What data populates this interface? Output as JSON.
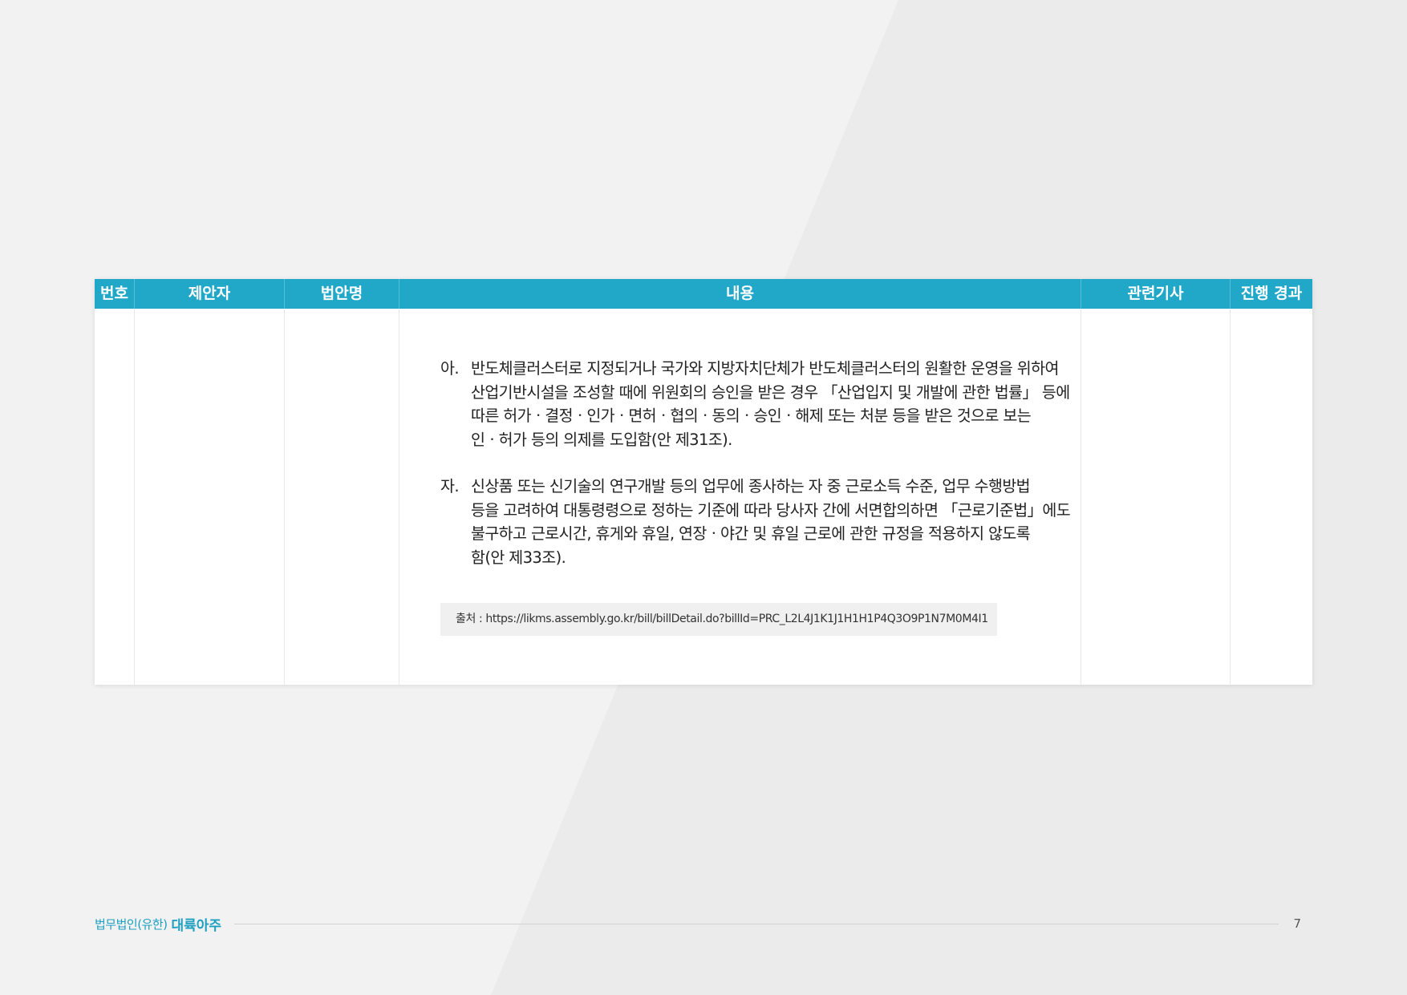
{
  "table": {
    "headers": {
      "no": "번호",
      "proposer": "제안자",
      "bill_name": "법안명",
      "content": "내용",
      "related_articles": "관련기사",
      "progress": "진행 경과"
    },
    "content": {
      "items": [
        {
          "marker": "아.",
          "lines": [
            "반도체클러스터로 지정되거나 국가와 지방자치단체가 반도체클러스터의 원활한 운영을 위하여",
            "산업기반시설을 조성할 때에 위원회의 승인을 받은 경우 「산업입지 및 개발에 관한 법률」 등에",
            "따른 허가ㆍ결정ㆍ인가ㆍ면허ㆍ협의ㆍ동의ㆍ승인ㆍ해제 또는 처분 등을 받은 것으로 보는",
            "인ㆍ허가 등의 의제를 도입함(안 제31조)."
          ]
        },
        {
          "marker": "자.",
          "lines": [
            "신상품 또는 신기술의 연구개발 등의 업무에 종사하는 자 중 근로소득 수준, 업무 수행방법",
            "등을 고려하여 대통령령으로 정하는 기준에 따라 당사자 간에 서면합의하면 「근로기준법」에도",
            "불구하고 근로시간, 휴게와 휴일, 연장ㆍ야간 및 휴일 근로에 관한 규정을 적용하지 않도록",
            "함(안 제33조)."
          ]
        }
      ],
      "source": "출처 : https://likms.assembly.go.kr/bill/billDetail.do?billId=PRC_L2L4J1K1J1H1H1P4Q3O9P1N7M0M4I1"
    }
  },
  "footer": {
    "firm": "법무법인(유한)",
    "brand": "대륙아주",
    "page_number": "7"
  },
  "colors": {
    "header_bg": "#21a8c9",
    "brand": "#1d9fc0",
    "background": "#f2f2f3"
  }
}
